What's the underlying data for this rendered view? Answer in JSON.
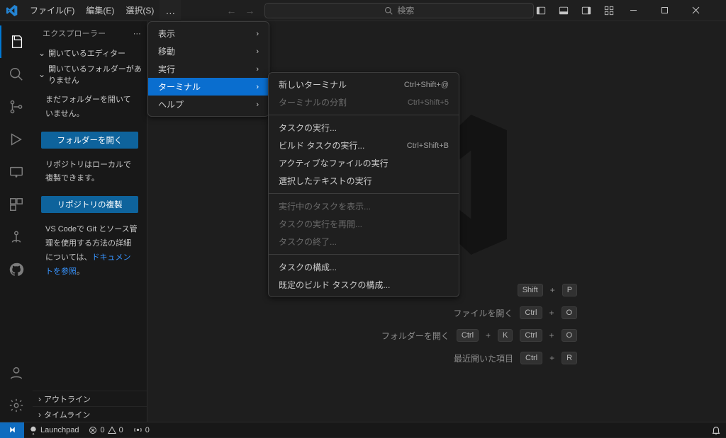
{
  "menubar": {
    "file": "ファイル(F)",
    "edit": "編集(E)",
    "selection": "選択(S)",
    "more": "…"
  },
  "search": {
    "placeholder": "検索"
  },
  "sidebar": {
    "title": "エクスプローラー",
    "openEditors": "開いているエディター",
    "noFolder": "開いているフォルダーがありません",
    "body1": "まだフォルダーを開いていません。",
    "btnOpen": "フォルダーを開く",
    "body2": "リポジトリはローカルで複製できます。",
    "btnClone": "リポジトリの複製",
    "body3a": "VS Codeで Git とソース管理を使用する方法の詳細については、",
    "body3link": "ドキュメントを参照",
    "body3b": "。",
    "outline": "アウトライン",
    "timeline": "タイムライン"
  },
  "menu1": {
    "view": "表示",
    "go": "移動",
    "run": "実行",
    "terminal": "ターミナル",
    "help": "ヘルプ"
  },
  "menu2": {
    "newTerminal": {
      "label": "新しいターミナル",
      "kbd": "Ctrl+Shift+@"
    },
    "split": {
      "label": "ターミナルの分割",
      "kbd": "Ctrl+Shift+5"
    },
    "runTask": {
      "label": "タスクの実行..."
    },
    "runBuild": {
      "label": "ビルド タスクの実行...",
      "kbd": "Ctrl+Shift+B"
    },
    "runActive": {
      "label": "アクティブなファイルの実行"
    },
    "runSelected": {
      "label": "選択したテキストの実行"
    },
    "showRunning": {
      "label": "実行中のタスクを表示..."
    },
    "restartTask": {
      "label": "タスクの実行を再開..."
    },
    "terminateTask": {
      "label": "タスクの終了..."
    },
    "configure": {
      "label": "タスクの構成..."
    },
    "configureDefault": {
      "label": "既定のビルド タスクの構成..."
    }
  },
  "watermark": {
    "row1": {
      "label": "",
      "keys": [
        "Shift",
        "+",
        "P"
      ]
    },
    "row2": {
      "label": "ファイルを開く",
      "keys": [
        "Ctrl",
        "+",
        "O"
      ]
    },
    "row3": {
      "label": "フォルダーを開く",
      "keys": [
        "Ctrl",
        "+",
        "K",
        "Ctrl",
        "+",
        "O"
      ]
    },
    "row4": {
      "label": "最近開いた項目",
      "keys": [
        "Ctrl",
        "+",
        "R"
      ]
    }
  },
  "status": {
    "launchpad": "Launchpad",
    "err": "0",
    "warn": "0",
    "port": "0"
  }
}
